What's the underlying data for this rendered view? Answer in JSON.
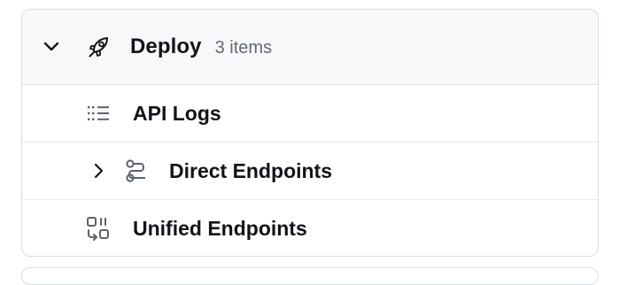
{
  "section": {
    "title": "Deploy",
    "count": "3 items",
    "expanded": true,
    "icons": {
      "toggle": "chevron-down-icon",
      "section": "rocket-icon"
    }
  },
  "items": [
    {
      "label": "API Logs",
      "icon": "list-icon",
      "expandable": false
    },
    {
      "label": "Direct Endpoints",
      "icon": "route-icon",
      "expandable": true,
      "expanded": false
    },
    {
      "label": "Unified Endpoints",
      "icon": "unified-endpoints-icon",
      "expandable": false
    }
  ],
  "colors": {
    "text": "#111418",
    "muted": "#636a73",
    "header_bg": "#f6f8fa",
    "border": "#d9dde2"
  }
}
